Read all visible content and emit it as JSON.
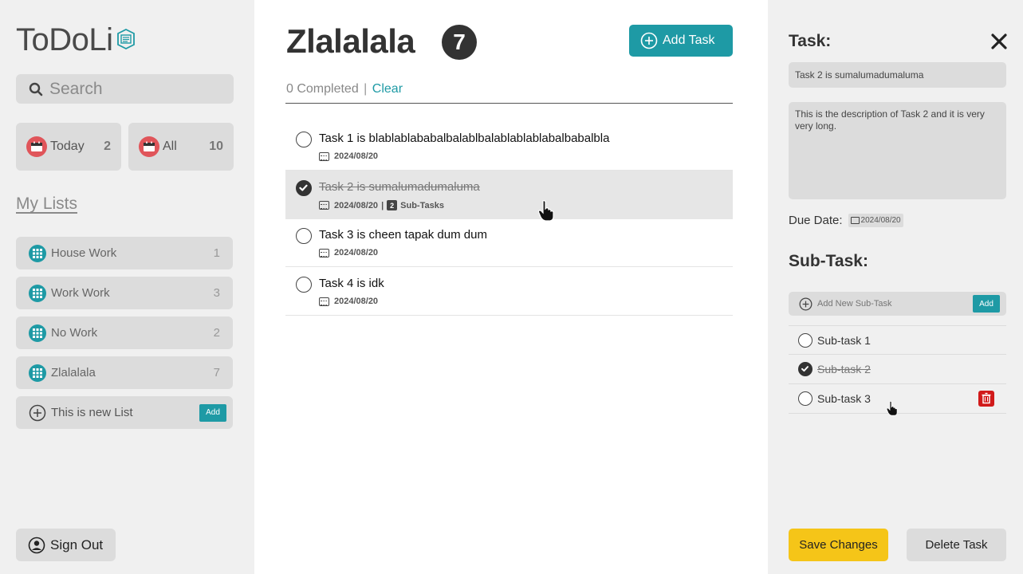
{
  "app": {
    "logo_text": "ToDoLi",
    "accent_color": "#1e9aa5",
    "calendar_color": "#e0555a"
  },
  "sidebar": {
    "search_placeholder": "Search",
    "smart_lists": [
      {
        "label": "Today",
        "count": "2",
        "icon": "calendar-icon"
      },
      {
        "label": "All",
        "count": "10",
        "icon": "calendar-icon"
      }
    ],
    "my_lists_heading": "My Lists",
    "lists": [
      {
        "label": "House Work",
        "count": "1",
        "icon": "grid-icon"
      },
      {
        "label": "Work Work",
        "count": "3",
        "icon": "grid-icon"
      },
      {
        "label": "No Work",
        "count": "2",
        "icon": "grid-icon"
      },
      {
        "label": "Zlalalala",
        "count": "7",
        "icon": "grid-icon"
      }
    ],
    "new_list_value": "This is new List",
    "new_list_add": "Add",
    "sign_out": "Sign Out"
  },
  "main": {
    "title": "Zlalalala",
    "count": "7",
    "add_task": "Add Task",
    "completed_text": "0 Completed",
    "separator": "|",
    "clear": "Clear",
    "tasks": [
      {
        "name": "Task 1 is blablablababalbalablbalablablablabalbabalbla",
        "date": "2024/08/20",
        "done": false
      },
      {
        "name": "Task 2 is sumalumadumaluma",
        "date": "2024/08/20",
        "sub_count": "2",
        "sub_label": "Sub-Tasks",
        "sub_sep": "|",
        "done": true
      },
      {
        "name": "Task 3 is cheen tapak dum dum",
        "date": "2024/08/20",
        "done": false
      },
      {
        "name": "Task 4 is idk",
        "date": "2024/08/20",
        "done": false
      }
    ]
  },
  "detail": {
    "heading": "Task:",
    "name_value": "Task 2 is sumalumadumaluma",
    "description": "This is the description of Task 2 and it is very very long.",
    "due_label": "Due Date:",
    "due_date": "2024/08/20",
    "subtask_heading": "Sub-Task:",
    "add_subtask_placeholder": "Add New Sub-Task",
    "add_subtask_button": "Add",
    "subtasks": [
      {
        "name": "Sub-task 1",
        "done": false
      },
      {
        "name": "Sub-task 2",
        "done": true
      },
      {
        "name": "Sub-task 3",
        "done": false
      }
    ],
    "save": "Save Changes",
    "delete": "Delete Task",
    "save_color": "#f5c518",
    "delete_color": "#d11a1a"
  }
}
